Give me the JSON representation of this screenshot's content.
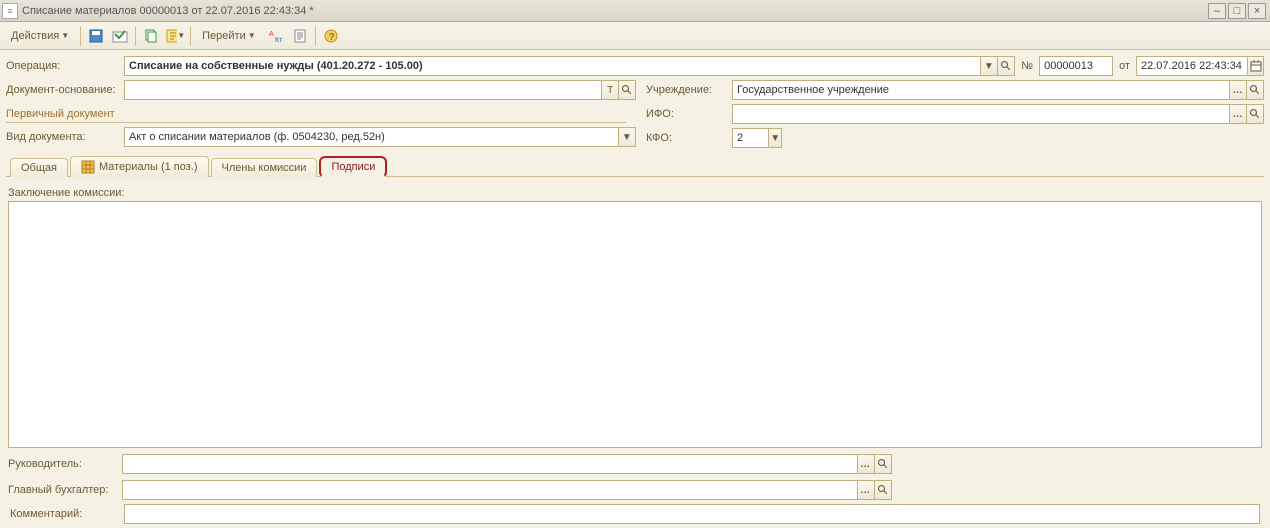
{
  "title": "Списание материалов 00000013 от 22.07.2016 22:43:34 *",
  "toolbar": {
    "actions": "Действия",
    "goto": "Перейти"
  },
  "labels": {
    "operation": "Операция:",
    "doc_base": "Документ-основание:",
    "primary_doc": "Первичный документ",
    "doc_type": "Вид документа:",
    "institution": "Учреждение:",
    "ifo": "ИФО:",
    "kfo": "КФО:",
    "num": "№",
    "from": "от",
    "conclusion": "Заключение комиссии:",
    "chief": "Руководитель:",
    "accountant": "Главный бухгалтер:",
    "comment": "Комментарий:"
  },
  "fields": {
    "operation": "Списание на собственные нужды (401.20.272 - 105.00)",
    "doc_base": "",
    "doc_type": "Акт о списании материалов (ф. 0504230, ред.52н)",
    "institution": "Государственное учреждение",
    "ifo": "",
    "kfo": "2",
    "number": "00000013",
    "date": "22.07.2016 22:43:34",
    "conclusion": "",
    "chief": "",
    "accountant": "",
    "comment": ""
  },
  "tabs": {
    "general": "Общая",
    "materials": "Материалы (1 поз.)",
    "commission": "Члены комиссии",
    "signatures": "Подписи"
  }
}
